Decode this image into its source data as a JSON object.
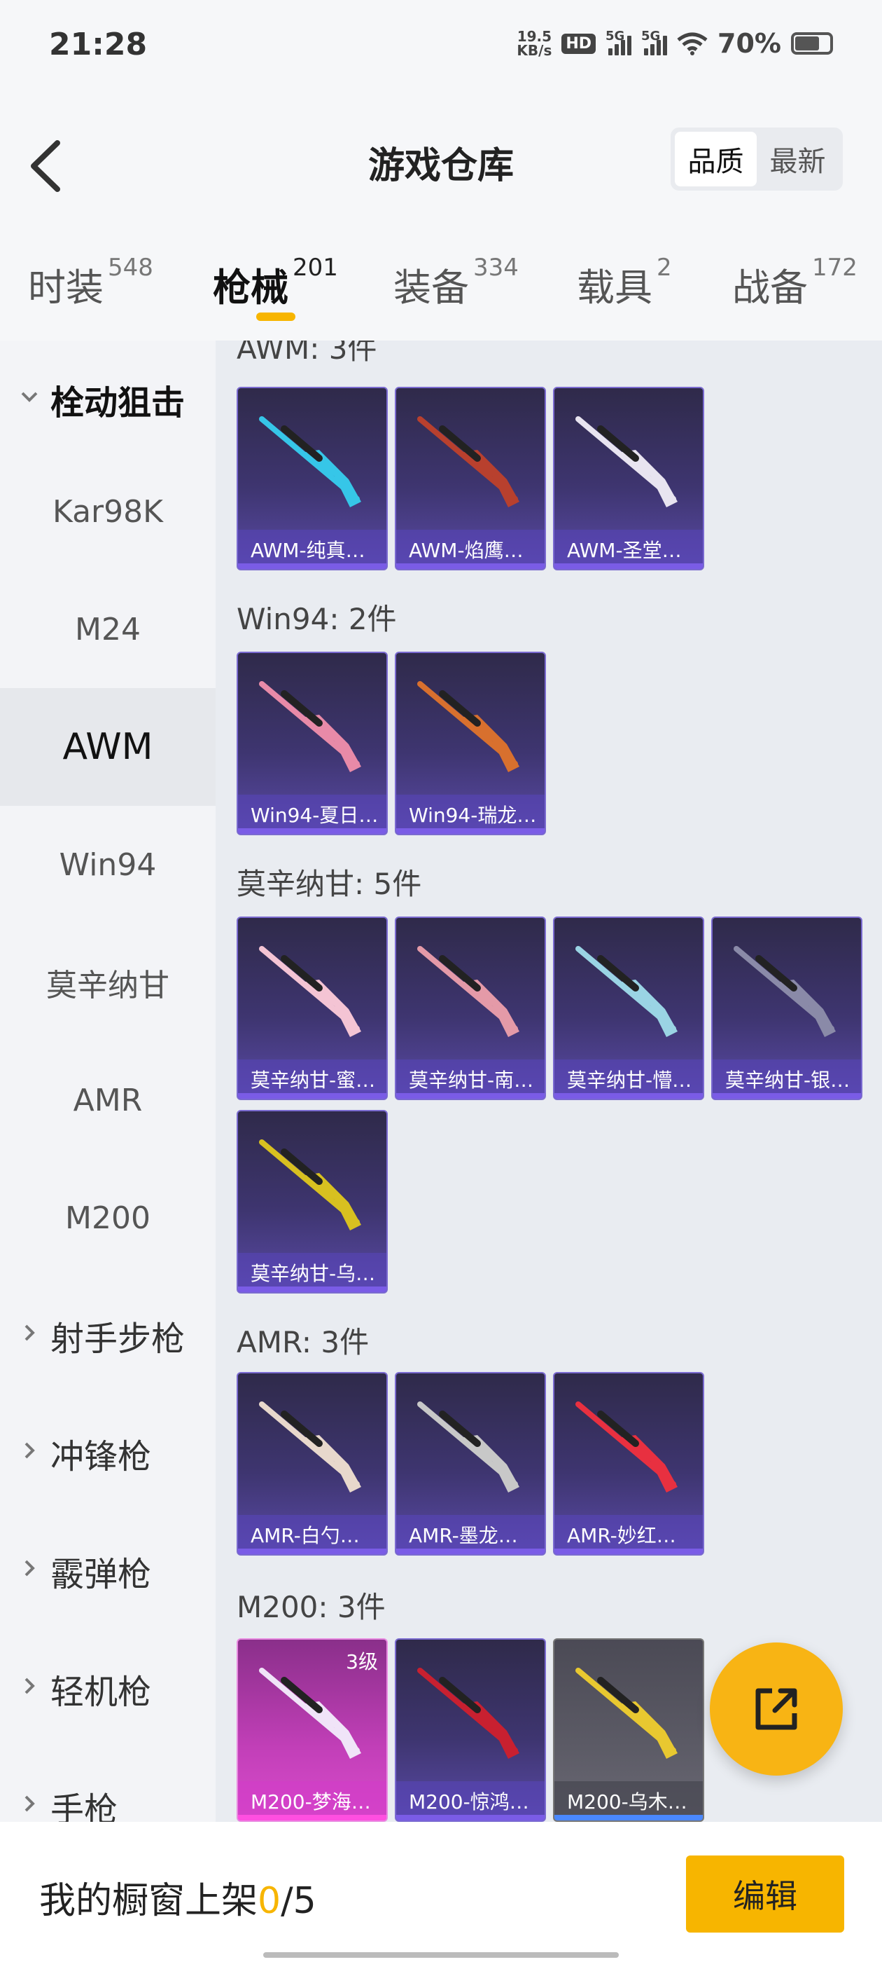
{
  "status_bar": {
    "time": "21:28",
    "net_speed_value": "19.5",
    "net_speed_unit": "KB/s",
    "hd_label": "HD",
    "sim1_label": "5G",
    "sim2_label": "5G",
    "battery_pct": "70%",
    "battery_level": 0.7
  },
  "header": {
    "title": "游戏仓库",
    "sort_options": [
      "品质",
      "最新"
    ],
    "sort_selected": "品质"
  },
  "tabs": [
    {
      "label": "时装",
      "count": "548",
      "active": false
    },
    {
      "label": "枪械",
      "count": "201",
      "active": true
    },
    {
      "label": "装备",
      "count": "334",
      "active": false
    },
    {
      "label": "载具",
      "count": "2",
      "active": false
    },
    {
      "label": "战备",
      "count": "172",
      "active": false
    }
  ],
  "sidebar": {
    "items": [
      {
        "label": "栓动狙击",
        "type": "group",
        "expanded": true
      },
      {
        "label": "Kar98K",
        "type": "sub"
      },
      {
        "label": "M24",
        "type": "sub"
      },
      {
        "label": "AWM",
        "type": "sub",
        "selected": true
      },
      {
        "label": "Win94",
        "type": "sub"
      },
      {
        "label": "莫辛纳甘",
        "type": "sub"
      },
      {
        "label": "AMR",
        "type": "sub"
      },
      {
        "label": "M200",
        "type": "sub"
      },
      {
        "label": "射手步枪",
        "type": "group"
      },
      {
        "label": "冲锋枪",
        "type": "group"
      },
      {
        "label": "霰弹枪",
        "type": "group"
      },
      {
        "label": "轻机枪",
        "type": "group"
      },
      {
        "label": "手枪",
        "type": "group"
      }
    ]
  },
  "sections": [
    {
      "title": "AWM: 3件",
      "items": [
        {
          "name": "AWM-纯真…",
          "color": "#36c6e8"
        },
        {
          "name": "AWM-焰鹰…",
          "color": "#b8402e"
        },
        {
          "name": "AWM-圣堂…",
          "color": "#e8e4f0"
        }
      ]
    },
    {
      "title": "Win94: 2件",
      "items": [
        {
          "name": "Win94-夏日…",
          "color": "#e88aa8"
        },
        {
          "name": "Win94-瑞龙…",
          "color": "#d8702e"
        }
      ]
    },
    {
      "title": "莫辛纳甘: 5件",
      "items": [
        {
          "name": "莫辛纳甘-蜜…",
          "color": "#f4c4d4"
        },
        {
          "name": "莫辛纳甘-南…",
          "color": "#e49aa8"
        },
        {
          "name": "莫辛纳甘-懵…",
          "color": "#9ad4e4"
        },
        {
          "name": "莫辛纳甘-银…",
          "color": "#8a8aa8"
        },
        {
          "name": "莫辛纳甘-乌…",
          "color": "#d8c020"
        }
      ]
    },
    {
      "title": "AMR: 3件",
      "items": [
        {
          "name": "AMR-白勺…",
          "color": "#e8d8cc"
        },
        {
          "name": "AMR-墨龙…",
          "color": "#c8c8c8"
        },
        {
          "name": "AMR-妙红…",
          "color": "#e83040"
        }
      ]
    },
    {
      "title": "M200: 3件",
      "items": [
        {
          "name": "M200-梦海…",
          "color": "#f0e4f8",
          "level": "3级",
          "style": "pink"
        },
        {
          "name": "M200-惊鸿…",
          "color": "#c82030"
        },
        {
          "name": "M200-乌木…",
          "color": "#e8c830",
          "style": "gray"
        }
      ]
    }
  ],
  "bottom": {
    "showcase_label": "我的橱窗上架",
    "showcase_count": "0",
    "showcase_total": "/5",
    "edit_label": "编辑"
  },
  "colors": {
    "accent": "#f7b500",
    "fab": "#f8b414"
  }
}
